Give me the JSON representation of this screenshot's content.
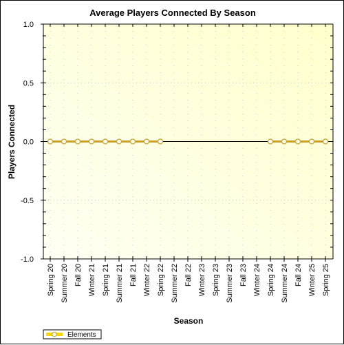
{
  "chart_data": {
    "type": "line",
    "title": "Average Players Connected By Season",
    "xlabel": "Season",
    "ylabel": "Players Connected",
    "ylim": [
      -1.0,
      1.0
    ],
    "yticks": [
      1.0,
      0.5,
      0.0,
      -0.5,
      -1.0
    ],
    "ytick_labels": [
      "1.0",
      "0.5",
      "0.0",
      "-0.5",
      "-1.0"
    ],
    "grid": true,
    "categories": [
      "Spring 20",
      "Summer 20",
      "Fall 20",
      "Winter 21",
      "Spring 21",
      "Summer 21",
      "Fall 21",
      "Winter 22",
      "Spring 22",
      "Summer 22",
      "Fall 22",
      "Winter 23",
      "Spring 23",
      "Summer 23",
      "Fall 23",
      "Winter 24",
      "Spring 24",
      "Summer 24",
      "Fall 24",
      "Winter 25",
      "Spring 25"
    ],
    "series": [
      {
        "name": "Elements",
        "color": "#c8a02a",
        "values": [
          0,
          0,
          0,
          0,
          0,
          0,
          0,
          0,
          0,
          null,
          null,
          null,
          null,
          null,
          null,
          null,
          0,
          0,
          0,
          0,
          0
        ]
      }
    ],
    "legend": {
      "placement": "bottom-left",
      "entries": [
        "Elements"
      ]
    },
    "colors": {
      "plot_bg_start": "#fffff4",
      "plot_bg_end": "#ffffcc",
      "grid": "#c8c8c8",
      "zero_line": "#000000",
      "legend_swatch": "#f5d800"
    }
  }
}
